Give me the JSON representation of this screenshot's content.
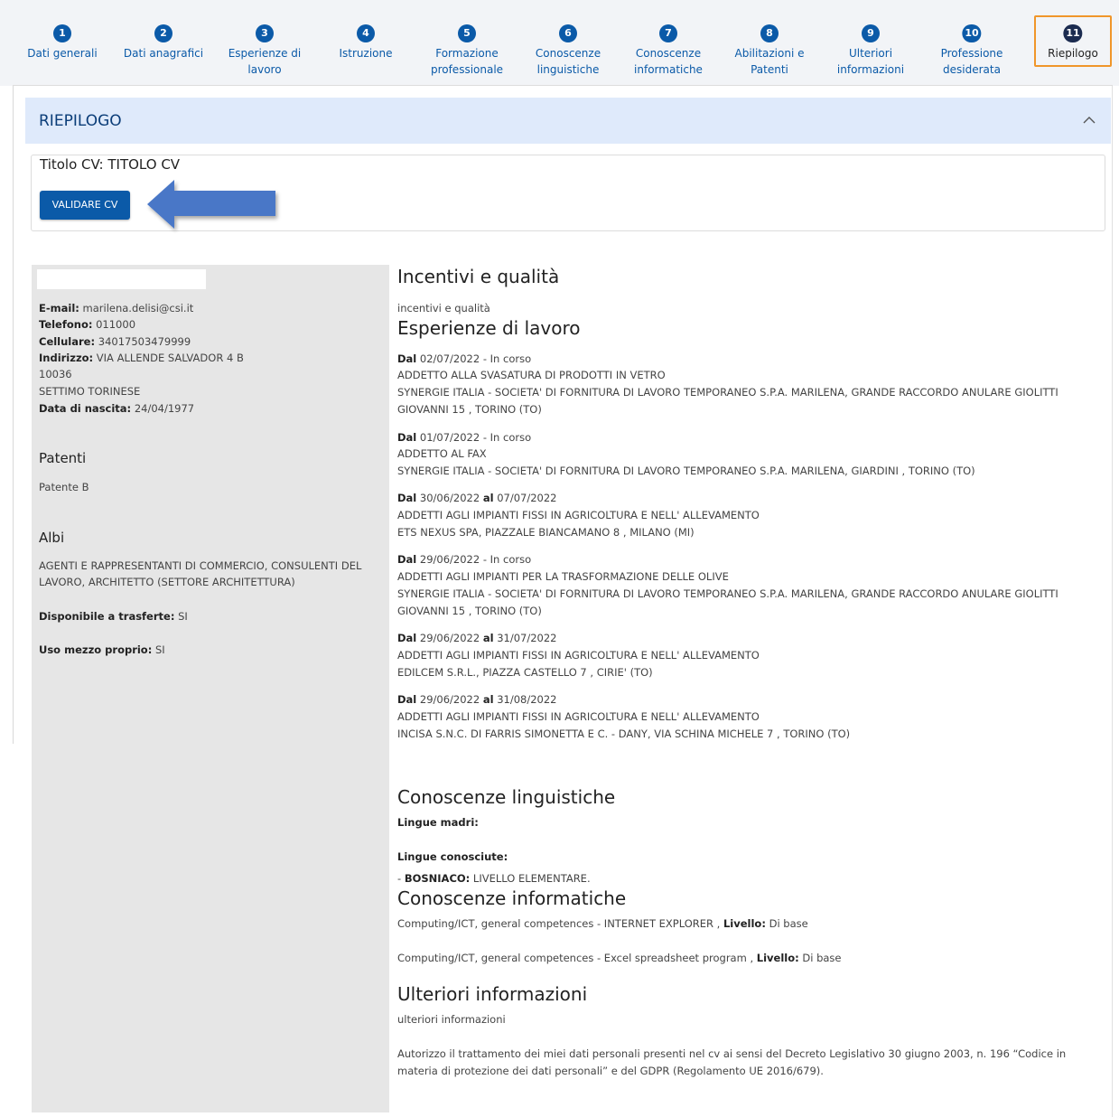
{
  "stepper": {
    "steps": [
      {
        "num": "1",
        "label": "Dati generali"
      },
      {
        "num": "2",
        "label": "Dati anagrafici"
      },
      {
        "num": "3",
        "label": "Esperienze di lavoro"
      },
      {
        "num": "4",
        "label": "Istruzione"
      },
      {
        "num": "5",
        "label": "Formazione professionale"
      },
      {
        "num": "6",
        "label": "Conoscenze linguistiche"
      },
      {
        "num": "7",
        "label": "Conoscenze informatiche"
      },
      {
        "num": "8",
        "label": "Abilitazioni e Patenti"
      },
      {
        "num": "9",
        "label": "Ulteriori informazioni"
      },
      {
        "num": "10",
        "label": "Professione desiderata"
      },
      {
        "num": "11",
        "label": "Riepilogo"
      }
    ],
    "active_index": 10,
    "active_highlight_color": "#f0962a"
  },
  "accordion": {
    "title": "RIEPILOGO",
    "chevron_icon": "chevron-up-icon"
  },
  "cv": {
    "title": "Titolo CV: TITOLO CV",
    "validate_label": "VALIDARE CV",
    "annotation_icon": "arrow-left-icon"
  },
  "personal": {
    "email_label": "E-mail:",
    "email": "marilena.delisi@csi.it",
    "phone_label": "Telefono:",
    "phone": "011000",
    "mobile_label": "Cellulare:",
    "mobile": "34017503479999",
    "address_label": "Indirizzo:",
    "address": "VIA ALLENDE SALVADOR 4 B",
    "zip": "10036",
    "city": "SETTIMO TORINESE",
    "birth_label": "Data di nascita:",
    "birth": "24/04/1977",
    "licenses_heading": "Patenti",
    "licenses": "Patente B",
    "albi_heading": "Albi",
    "albi_line1": "AGENTI E RAPPRESENTANTI DI COMMERCIO, CONSULENTI DEL",
    "albi_line2": "LAVORO, ARCHITETTO (SETTORE ARCHITETTURA)",
    "transfer_label": "Disponibile a trasferte:",
    "transfer": "SI",
    "vehicle_label": "Uso mezzo proprio:",
    "vehicle": "SI"
  },
  "incentives": {
    "heading": "Incentivi e qualità",
    "text": "incentivi e qualità"
  },
  "experience": {
    "heading": "Esperienze di lavoro",
    "from_label": "Dal",
    "to_label": "al",
    "items": [
      {
        "from": "02/07/2022",
        "to_text": " - In corso",
        "to": "",
        "role": "ADDETTO ALLA SVASATURA DI PRODOTTI IN VETRO",
        "company": "SYNERGIE ITALIA - SOCIETA' DI FORNITURA DI LAVORO TEMPORANEO S.P.A. MARILENA, GRANDE RACCORDO ANULARE GIOLITTI",
        "company2": "GIOVANNI 15 , TORINO (TO)"
      },
      {
        "from": "01/07/2022",
        "to_text": " - In corso",
        "to": "",
        "role": "ADDETTO AL FAX",
        "company": "SYNERGIE ITALIA - SOCIETA' DI FORNITURA DI LAVORO TEMPORANEO S.P.A. MARILENA, GIARDINI , TORINO (TO)",
        "company2": ""
      },
      {
        "from": "30/06/2022",
        "to_text": "",
        "to": "07/07/2022",
        "role": "ADDETTI AGLI IMPIANTI FISSI IN AGRICOLTURA E NELL' ALLEVAMENTO",
        "company": "ETS NEXUS SPA, PIAZZALE BIANCAMANO 8 , MILANO (MI)",
        "company2": ""
      },
      {
        "from": "29/06/2022",
        "to_text": " - In corso",
        "to": "",
        "role": "ADDETTI AGLI IMPIANTI PER LA TRASFORMAZIONE DELLE OLIVE",
        "company": "SYNERGIE ITALIA - SOCIETA' DI FORNITURA DI LAVORO TEMPORANEO S.P.A. MARILENA, GRANDE RACCORDO ANULARE GIOLITTI",
        "company2": "GIOVANNI 15 , TORINO (TO)"
      },
      {
        "from": "29/06/2022",
        "to_text": "",
        "to": "31/07/2022",
        "role": "ADDETTI AGLI IMPIANTI FISSI IN AGRICOLTURA E NELL' ALLEVAMENTO",
        "company": "EDILCEM S.R.L., PIAZZA CASTELLO 7 , CIRIE' (TO)",
        "company2": ""
      },
      {
        "from": "29/06/2022",
        "to_text": "",
        "to": "31/08/2022",
        "role": "ADDETTI AGLI IMPIANTI FISSI IN AGRICOLTURA E NELL' ALLEVAMENTO",
        "company": "INCISA S.N.C. DI FARRIS SIMONETTA E C. - DANY, VIA SCHINA MICHELE 7 , TORINO (TO)",
        "company2": ""
      }
    ]
  },
  "languages": {
    "heading": "Conoscenze linguistiche",
    "mother_label": "Lingue madri:",
    "known_label": "Lingue conosciute:",
    "known_prefix": "- ",
    "known_name": "BOSNIACO:",
    "known_level": "LIVELLO ELEMENTARE."
  },
  "it_skills": {
    "heading": "Conoscenze informatiche",
    "level_label": "Livello:",
    "items": [
      {
        "text": "Computing/ICT, general competences - INTERNET EXPLORER ,",
        "level": "Di base"
      },
      {
        "text": "Computing/ICT, general competences - Excel spreadsheet program ,",
        "level": "Di base"
      }
    ]
  },
  "further": {
    "heading": "Ulteriori informazioni",
    "text": "ulteriori informazioni",
    "consent_line1": "Autorizzo il trattamento dei miei dati personali presenti nel cv ai sensi del Decreto Legislativo 30 giugno 2003, n. 196 “Codice in",
    "consent_line2": "materia di protezione dei dati personali” e del GDPR (Regolamento UE 2016/679)."
  }
}
